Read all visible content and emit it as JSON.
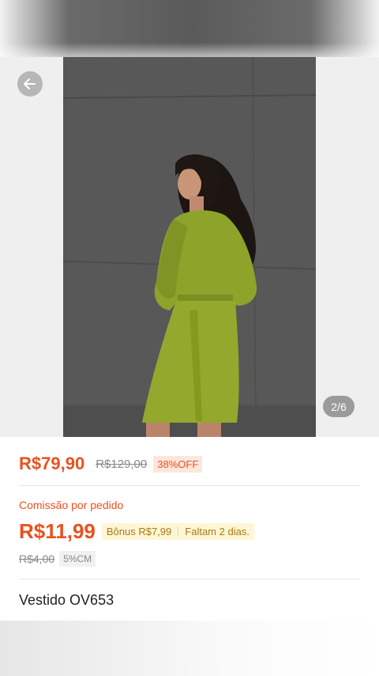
{
  "gallery": {
    "counter": "2/6",
    "photo_description": "woman in green long-sleeve dress against concrete wall"
  },
  "pricing": {
    "price": "R$79,90",
    "original_price": "R$129,00",
    "discount": "38%OFF"
  },
  "commission": {
    "label": "Comissão por pedido",
    "amount": "R$11,99",
    "bonus": "Bônus R$7,99",
    "deadline": "Faltam 2 dias.",
    "original_amount": "R$4,00",
    "rate": "5%CM"
  },
  "product": {
    "title": "Vestido OV653"
  },
  "colors": {
    "accent": "#e8521f",
    "dress": "#8fa52a",
    "wall": "#555555"
  }
}
